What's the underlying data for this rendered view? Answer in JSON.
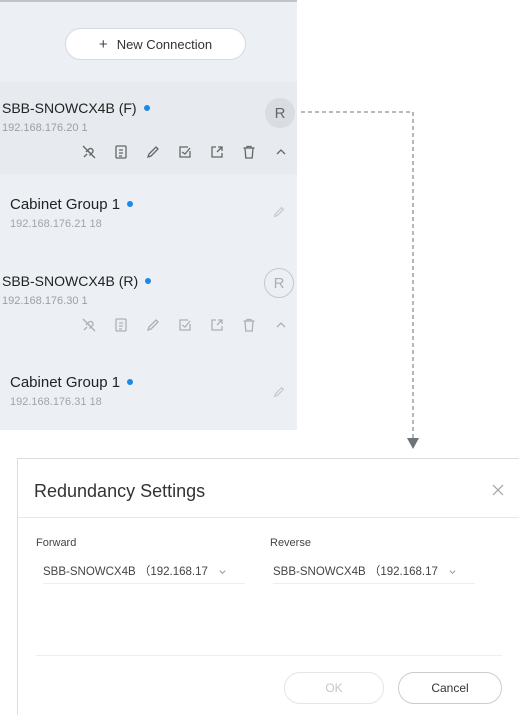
{
  "sidebar": {
    "new_connection_label": "New Connection",
    "devices": [
      {
        "name": "SBB-SNOWCX4B (F)",
        "ip": "192.168.176.20 1",
        "role": "R",
        "group": {
          "name": "Cabinet Group 1",
          "ip": "192.168.176.21 18"
        }
      },
      {
        "name": "SBB-SNOWCX4B (R)",
        "ip": "192.168.176.30 1",
        "role": "R",
        "group": {
          "name": "Cabinet Group 1",
          "ip": "192.168.176.31 18"
        }
      }
    ]
  },
  "dialog": {
    "title": "Redundancy Settings",
    "forward_label": "Forward",
    "forward_value": "SBB-SNOWCX4B （192.168.17",
    "reverse_label": "Reverse",
    "reverse_value": "SBB-SNOWCX4B （192.168.17",
    "ok_label": "OK",
    "cancel_label": "Cancel"
  },
  "colors": {
    "status_dot": "#1e88e5",
    "panel_bg": "#eceff3",
    "connector": "#8a8f96"
  }
}
